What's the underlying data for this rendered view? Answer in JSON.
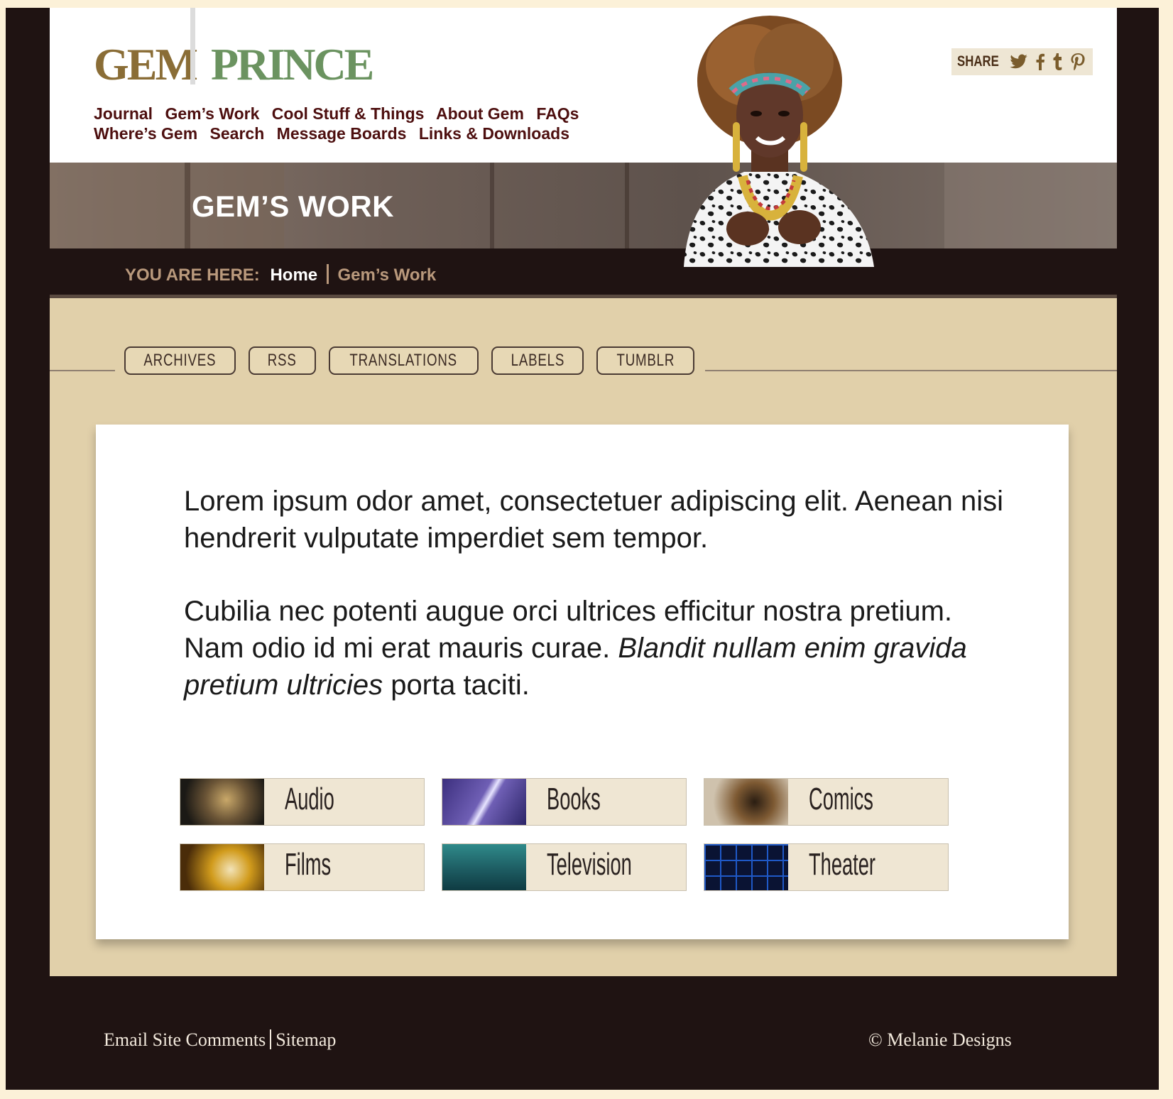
{
  "logo": {
    "part1": "GEM",
    "part2": "PRINCE"
  },
  "nav": {
    "row1": [
      "Journal",
      "Gem’s Work",
      "Cool Stuff & Things",
      "About Gem",
      "FAQs"
    ],
    "row2": [
      "Where’s Gem",
      "Search",
      "Message Boards",
      "Links & Downloads"
    ]
  },
  "share": {
    "label": "SHARE",
    "icons": [
      "twitter-icon",
      "facebook-icon",
      "tumblr-icon",
      "pinterest-icon"
    ]
  },
  "banner": {
    "title": "GEM’S WORK"
  },
  "breadcrumb": {
    "label": "YOU ARE HERE:",
    "home": "Home",
    "current": "Gem’s Work"
  },
  "tabs": [
    "ARCHIVES",
    "RSS",
    "TRANSLATIONS",
    "LABELS",
    "TUMBLR"
  ],
  "content": {
    "para1": "Lorem ipsum odor amet, consectetuer adipiscing elit. Aenean nisi hendrerit vulputate imperdiet sem tempor.",
    "para2_normal": "Cubilia nec potenti augue orci ultrices efficitur nostra pretium. Nam odio id mi erat mauris curae. ",
    "para2_italic": "Blandit nullam enim gravida pretium ultricies",
    "para2_end": " porta taciti."
  },
  "categories": [
    "Audio",
    "Books",
    "Comics",
    "Films",
    "Television",
    "Theater"
  ],
  "footer": {
    "email": "Email Site Comments",
    "sitemap": "Sitemap",
    "copyright": "© Melanie Designs"
  },
  "colors": {
    "frame": "#1f1312",
    "page_bg": "#fcf1d8",
    "content_bg": "#e1d0aa",
    "nav_text": "#4d0f0f",
    "logo_gem": "#8a6d36",
    "logo_prince": "#6b9360"
  }
}
